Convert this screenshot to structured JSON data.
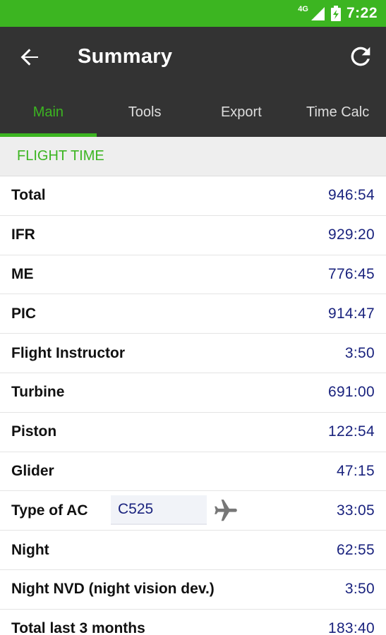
{
  "status_bar": {
    "network": "4G",
    "time": "7:22"
  },
  "app_bar": {
    "title": "Summary",
    "back_icon": "arrow-back-icon",
    "refresh_icon": "refresh-icon"
  },
  "tabs": [
    {
      "label": "Main",
      "active": true
    },
    {
      "label": "Tools",
      "active": false
    },
    {
      "label": "Export",
      "active": false
    },
    {
      "label": "Time Calc",
      "active": false
    }
  ],
  "section": {
    "title": "FLIGHT TIME"
  },
  "rows": [
    {
      "label": "Total",
      "value": "946:54"
    },
    {
      "label": "IFR",
      "value": "929:20"
    },
    {
      "label": "ME",
      "value": "776:45"
    },
    {
      "label": "PIC",
      "value": "914:47"
    },
    {
      "label": "Flight Instructor",
      "value": "3:50"
    },
    {
      "label": "Turbine",
      "value": "691:00"
    },
    {
      "label": "Piston",
      "value": "122:54"
    },
    {
      "label": "Glider",
      "value": "47:15"
    },
    {
      "label": "Type of AC",
      "value": "33:05",
      "input_value": "C525",
      "icon": "airplane-icon"
    },
    {
      "label": "Night",
      "value": "62:55"
    },
    {
      "label": "Night NVD (night vision dev.)",
      "value": "3:50"
    },
    {
      "label": "Total last 3 months",
      "value": "183:40"
    }
  ],
  "colors": {
    "accent": "#3cb521",
    "app_bar": "#333333",
    "value_text": "#1a237e"
  }
}
